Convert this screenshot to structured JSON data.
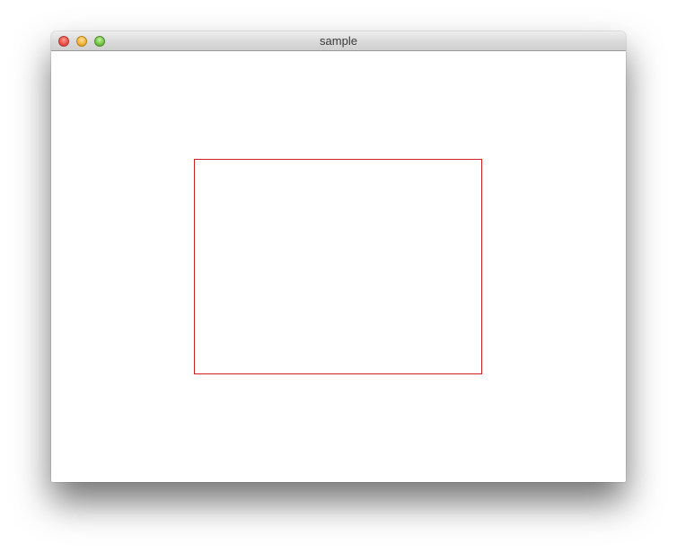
{
  "window": {
    "title": "sample"
  },
  "controls": {
    "close_icon": "close-icon",
    "minimize_icon": "minimize-icon",
    "maximize_icon": "maximize-icon"
  },
  "canvas": {
    "background": "#ffffff",
    "rectangle_stroke_color": "#d01f1f"
  }
}
